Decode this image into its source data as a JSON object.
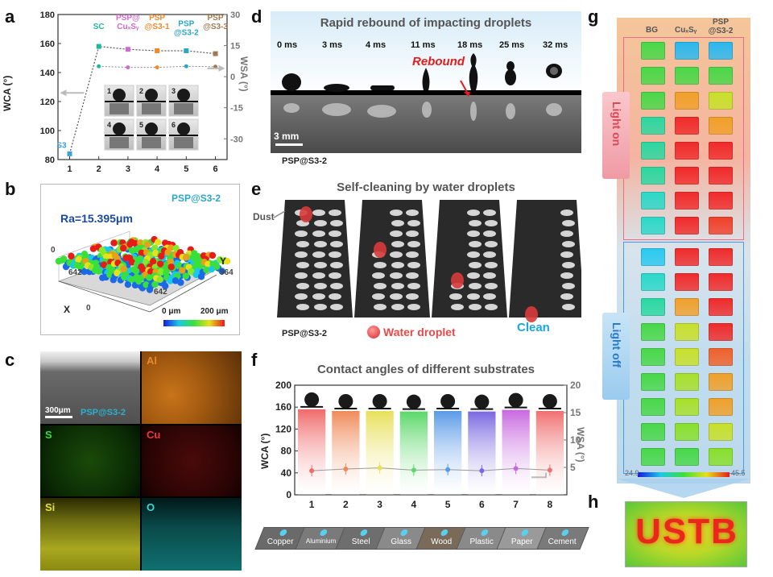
{
  "panel_labels": {
    "a": "a",
    "b": "b",
    "c": "c",
    "d": "d",
    "e": "e",
    "f": "f",
    "g": "g",
    "h": "h"
  },
  "chart_data": [
    {
      "id": "a",
      "type": "line",
      "xlabel": "",
      "ylabel": "WCA (°)",
      "y2label": "WSA (°)",
      "x": [
        1,
        2,
        3,
        4,
        5,
        6
      ],
      "xticks": [
        "1",
        "2",
        "3",
        "4",
        "5",
        "6"
      ],
      "ylim": [
        80,
        180
      ],
      "yticks": [
        "80",
        "100",
        "120",
        "140",
        "160",
        "180"
      ],
      "y2lim": [
        -40,
        30
      ],
      "y2ticks": [
        "-30",
        "-15",
        "0",
        "15",
        "30"
      ],
      "series": [
        {
          "axis": "left",
          "values": [
            84,
            158,
            156,
            155,
            155,
            153
          ],
          "color": "#555555"
        },
        {
          "axis": "right",
          "values": [
            null,
            5,
            4.5,
            4.5,
            5,
            4.8
          ],
          "color": "#888888"
        }
      ],
      "point_labels": [
        {
          "x": 1,
          "text": "S3",
          "color": "#3aa0d8"
        },
        {
          "x": 2,
          "text": "SC",
          "color": "#21b89a"
        },
        {
          "x": 3,
          "text": "PSP@ CuₓSᵧ",
          "color": "#d069d0"
        },
        {
          "x": 4,
          "text": "PSP @S3-1",
          "color": "#f08a2c"
        },
        {
          "x": 5,
          "text": "PSP @S3-2",
          "color": "#2aa6c8"
        },
        {
          "x": 6,
          "text": "PSP @S3-3",
          "color": "#a57850"
        }
      ],
      "inset_numbers": [
        "1",
        "2",
        "3",
        "4",
        "5",
        "6"
      ]
    },
    {
      "id": "f",
      "type": "bar",
      "title": "Contact angles of different substrates",
      "ylabel": "WCA (°)",
      "y2label": "WSA (°)",
      "categories": [
        "1",
        "2",
        "3",
        "4",
        "5",
        "6",
        "7",
        "8"
      ],
      "ylim": [
        0,
        200
      ],
      "yticks": [
        "0",
        "40",
        "80",
        "120",
        "160",
        "200"
      ],
      "y2lim": [
        0,
        20
      ],
      "y2ticks": [
        "5",
        "10",
        "15",
        "20"
      ],
      "values": [
        156,
        153,
        153,
        152,
        153,
        152,
        155,
        153
      ],
      "wsa_values": [
        4.4,
        4.7,
        4.9,
        4.5,
        4.6,
        4.4,
        4.8,
        4.5
      ],
      "colors": [
        "#f06a6a",
        "#f08a5a",
        "#e8e05a",
        "#5ad868",
        "#5a9ae8",
        "#7a68e0",
        "#c868e0",
        "#f07070"
      ]
    }
  ],
  "panel_b": {
    "ra": "Ra=15.395μm",
    "sample": "PSP@S3-2",
    "axis_x": "X",
    "axis_y": "Y",
    "tick_0a": "0",
    "tick_642a": "642",
    "tick_0b": "0",
    "tick_642b": "642",
    "tick_964": "964",
    "cbar_min": "0 μm",
    "cbar_max": "200 μm"
  },
  "panel_c": {
    "scale": "300μm",
    "sample": "PSP@S3-2",
    "elements": [
      "Al",
      "S",
      "Cu",
      "Si",
      "O"
    ]
  },
  "panel_d": {
    "title": "Rapid rebound of impacting droplets",
    "times": [
      "0 ms",
      "3 ms",
      "4 ms",
      "11 ms",
      "18 ms",
      "25 ms",
      "32 ms"
    ],
    "rebound": "Rebound",
    "scale": "3 mm",
    "sample": "PSP@S3-2"
  },
  "panel_e": {
    "title": "Self-cleaning by water droplets",
    "dust": "Dust",
    "sample": "PSP@S3-2",
    "droplet": "Water droplet",
    "clean": "Clean"
  },
  "panel_f_substrates": [
    "Copper",
    "Aluminium",
    "Steel",
    "Glass",
    "Wood",
    "Plastic",
    "Paper",
    "Cement"
  ],
  "panel_g": {
    "col_bg": "BG",
    "col_cuxsy": "CuₓSᵧ",
    "col_psp": "PSP @S3-2",
    "light_on": "Light on",
    "light_off": "Light off",
    "cbar_min": "24.9",
    "cbar_max": "45.5"
  },
  "panel_h": {
    "text": "USTB"
  }
}
